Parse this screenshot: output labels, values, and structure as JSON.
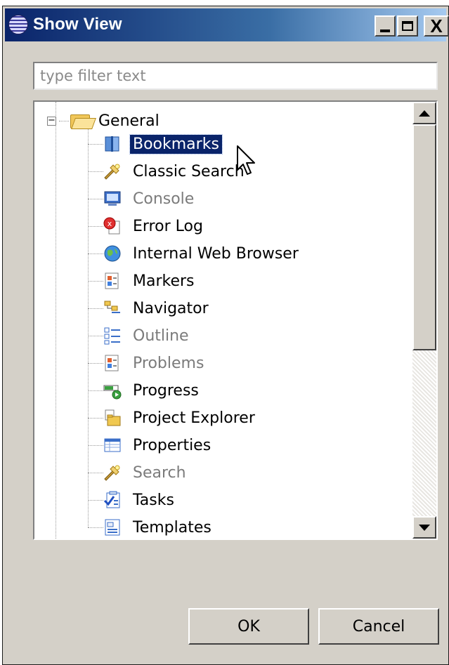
{
  "window": {
    "title": "Show View",
    "controls": {
      "minimize": "_",
      "maximize": "□",
      "close": "X"
    }
  },
  "filter": {
    "placeholder": "type filter text",
    "value": ""
  },
  "tree": {
    "root": {
      "label": "General",
      "icon": "folder-open-icon",
      "expanded": true
    },
    "items": [
      {
        "label": "Bookmarks",
        "icon": "bookmarks-icon",
        "selected": true,
        "disabled": false
      },
      {
        "label": "Classic Search",
        "icon": "search-flashlight-icon",
        "disabled": false
      },
      {
        "label": "Console",
        "icon": "console-icon",
        "disabled": true
      },
      {
        "label": "Error Log",
        "icon": "error-log-icon",
        "disabled": false
      },
      {
        "label": "Internal Web Browser",
        "icon": "globe-icon",
        "disabled": false
      },
      {
        "label": "Markers",
        "icon": "markers-icon",
        "disabled": false
      },
      {
        "label": "Navigator",
        "icon": "navigator-icon",
        "disabled": false
      },
      {
        "label": "Outline",
        "icon": "outline-icon",
        "disabled": true
      },
      {
        "label": "Problems",
        "icon": "problems-icon",
        "disabled": true
      },
      {
        "label": "Progress",
        "icon": "progress-icon",
        "disabled": false
      },
      {
        "label": "Project Explorer",
        "icon": "project-explorer-icon",
        "disabled": false
      },
      {
        "label": "Properties",
        "icon": "properties-icon",
        "disabled": false
      },
      {
        "label": "Search",
        "icon": "search-flashlight-icon",
        "disabled": true
      },
      {
        "label": "Tasks",
        "icon": "tasks-icon",
        "disabled": false
      },
      {
        "label": "Templates",
        "icon": "templates-icon",
        "disabled": false
      }
    ]
  },
  "buttons": {
    "ok": "OK",
    "cancel": "Cancel"
  },
  "colors": {
    "selection": "#0a246a",
    "dialog_bg": "#d4d0c8",
    "title_start": "#0a246a"
  }
}
